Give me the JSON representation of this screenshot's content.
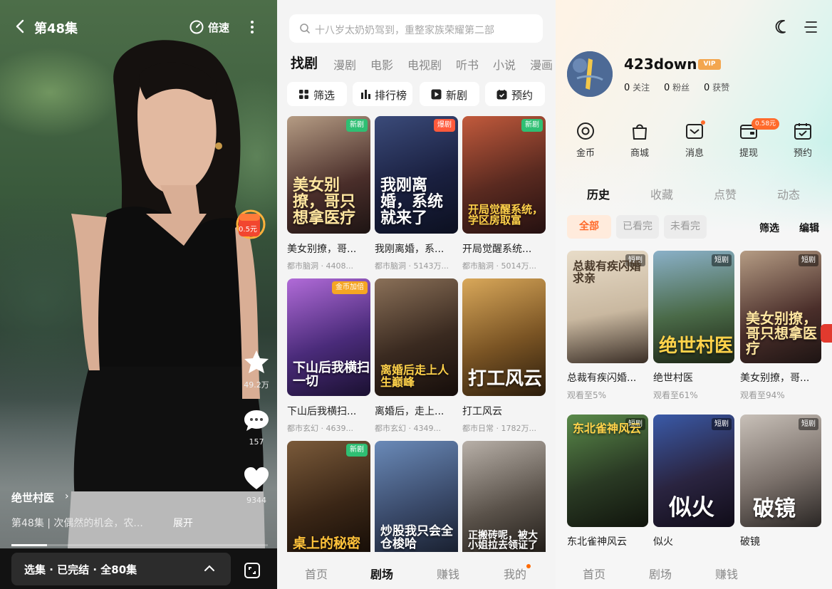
{
  "player": {
    "episode_title": "第48集",
    "speed_label": "倍速",
    "coin_reward": "0.5元",
    "likes_count": "49.2万",
    "comments_count": "157",
    "hearts_count": "9344",
    "drama_name": "绝世村医",
    "drama_name_chevron": "›",
    "episode_desc": "第48集 |  次偶然的机会，农...",
    "expand_label": "展开",
    "selector_label": "选集 · 已完结 · 全80集",
    "progress_fraction": 0.14
  },
  "theatre": {
    "search_placeholder": "十八岁太奶奶驾到，重整家族荣耀第二部",
    "tabs": [
      "找剧",
      "漫剧",
      "电影",
      "电视剧",
      "听书",
      "小说",
      "漫画"
    ],
    "quick_buttons": [
      "筛选",
      "排行榜",
      "新剧",
      "预约"
    ],
    "cards": [
      {
        "title": "美女别撩，哥...",
        "meta": "都市脑洞 · 4408...",
        "tag": "新剧",
        "art": "美女别撩，哥只想拿医疗"
      },
      {
        "title": "我刚离婚，系...",
        "meta": "都市脑洞 · 5143万...",
        "tag": "爆剧",
        "art": "我刚离婚，系统就来了"
      },
      {
        "title": "开局觉醒系统...",
        "meta": "都市脑洞 · 5014万...",
        "tag": "新剧",
        "art": "开局觉醒系统，学区房取富"
      },
      {
        "title": "下山后我横扫...",
        "meta": "都市玄幻 · 4639...",
        "tag": "金币加倍",
        "art": "下山后我横扫一切"
      },
      {
        "title": "离婚后，走上...",
        "meta": "都市玄幻 · 4349...",
        "tag": "",
        "art": "离婚后走上人生巅峰"
      },
      {
        "title": "打工风云",
        "meta": "都市日常 · 1782万...",
        "tag": "",
        "art": "打工风云"
      },
      {
        "title": "",
        "meta": "",
        "tag": "新剧",
        "art": "桌上的秘密"
      },
      {
        "title": "",
        "meta": "",
        "tag": "",
        "art": "炒股我只会全仓梭哈"
      },
      {
        "title": "",
        "meta": "",
        "tag": "",
        "art": "正搬砖呢，被大小姐拉去领证了"
      }
    ],
    "nav": [
      "首页",
      "剧场",
      "赚钱",
      "我的"
    ]
  },
  "profile": {
    "username": "423down",
    "vip_label": "VIP",
    "stats": [
      {
        "value": "0",
        "label": "关注"
      },
      {
        "value": "0",
        "label": "粉丝"
      },
      {
        "value": "0",
        "label": "获赞"
      }
    ],
    "quick": [
      "金币",
      "商城",
      "消息",
      "提现",
      "预约"
    ],
    "withdraw_badge": "0.58元",
    "tabs": [
      "历史",
      "收藏",
      "点赞",
      "动态"
    ],
    "filters": [
      "全部",
      "已看完",
      "未看完"
    ],
    "filter_action": "筛选",
    "edit_action": "编辑",
    "cards": [
      {
        "title": "总裁有疾闪婚...",
        "progress": "观看至5%",
        "tag": "短剧",
        "art": "总裁有疾闪婚求亲"
      },
      {
        "title": "绝世村医",
        "progress": "观看至61%",
        "tag": "短剧",
        "art": "绝世村医"
      },
      {
        "title": "美女别撩，哥...",
        "progress": "观看至94%",
        "tag": "短剧",
        "art": "美女别撩，哥只想拿医疗"
      },
      {
        "title": "东北雀神风云",
        "progress": "",
        "tag": "短剧",
        "art": "东北雀神风云"
      },
      {
        "title": "似火",
        "progress": "",
        "tag": "短剧",
        "art": "似火"
      },
      {
        "title": "破镜",
        "progress": "",
        "tag": "短剧",
        "art": "破镜"
      }
    ],
    "nav": [
      "首页",
      "剧场",
      "赚钱"
    ]
  },
  "colors": {
    "accent": "#ff6a2b",
    "new_tag": "#2fbf73",
    "hot_tag": "#ff5a3c",
    "gold_tag": "#f5a623"
  }
}
